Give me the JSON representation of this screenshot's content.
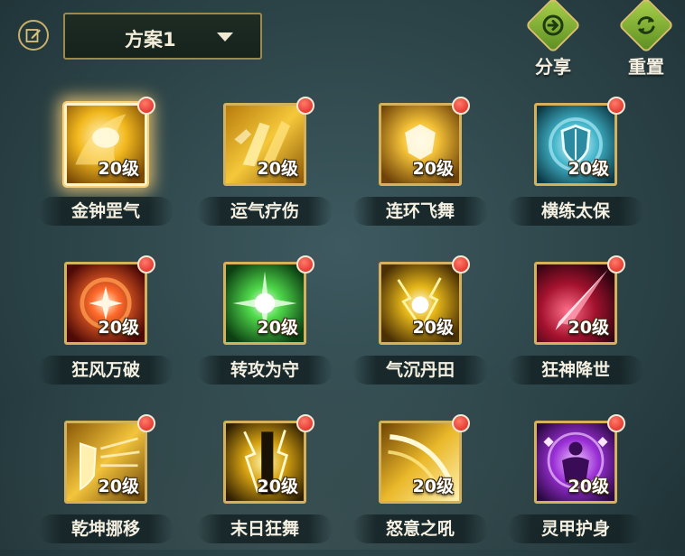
{
  "header": {
    "scheme_label": "方案1",
    "share_label": "分享",
    "reset_label": "重置"
  },
  "icons": {
    "edit": "edit-icon",
    "dropdown": "caret-down-icon",
    "share": "share-icon",
    "reset": "reset-icon"
  },
  "skills": [
    {
      "name": "金钟罡气",
      "level": "20级",
      "selected": true
    },
    {
      "name": "运气疗伤",
      "level": "20级"
    },
    {
      "name": "连环飞舞",
      "level": "20级"
    },
    {
      "name": "横练太保",
      "level": "20级"
    },
    {
      "name": "狂风万破",
      "level": "20级"
    },
    {
      "name": "转攻为守",
      "level": "20级"
    },
    {
      "name": "气沉丹田",
      "level": "20级"
    },
    {
      "name": "狂神降世",
      "level": "20级"
    },
    {
      "name": "乾坤挪移",
      "level": "20级"
    },
    {
      "name": "末日狂舞",
      "level": "20级"
    },
    {
      "name": "怒意之吼",
      "level": "20级"
    },
    {
      "name": "灵甲护身",
      "level": "20级"
    }
  ]
}
